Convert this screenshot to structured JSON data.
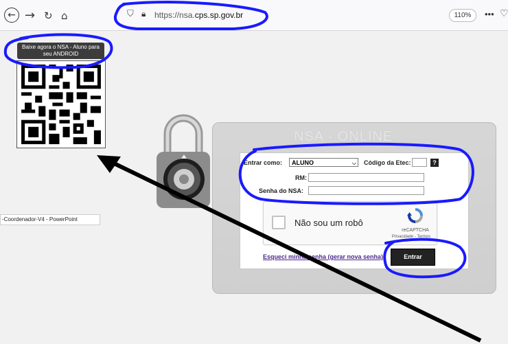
{
  "browser": {
    "url_prefix": "https://nsa.",
    "url_domain": "cps.sp.gov.br",
    "zoom": "110%",
    "more": "•••",
    "back_icon": "arrow-left-icon",
    "forward_icon": "arrow-right-icon",
    "reload_icon": "reload-icon",
    "home_icon": "home-icon"
  },
  "page": {
    "android_line1": "Baixe agora o NSA - Aluno para",
    "android_line2": "seu ANDROID",
    "ppt_label": "-Coordenador-V4 - PowerPoint",
    "title": "NSA - ONLINE"
  },
  "form": {
    "entrar_como_label": "Entrar como:",
    "entrar_como_value": "ALUNO",
    "codigo_label": "Código da Etec:",
    "help": "?",
    "rm_label": "RM:",
    "senha_label": "Senha do NSA:",
    "forgot": "Esqueci minha senha (gerar nova senha)",
    "enter": "Entrar"
  },
  "captcha": {
    "label": "Não sou um robô",
    "brand": "reCAPTCHA",
    "links": "Privacidade - Termos"
  },
  "colors": {
    "annotation_blue": "#1a1aff",
    "arrow": "#000000"
  }
}
